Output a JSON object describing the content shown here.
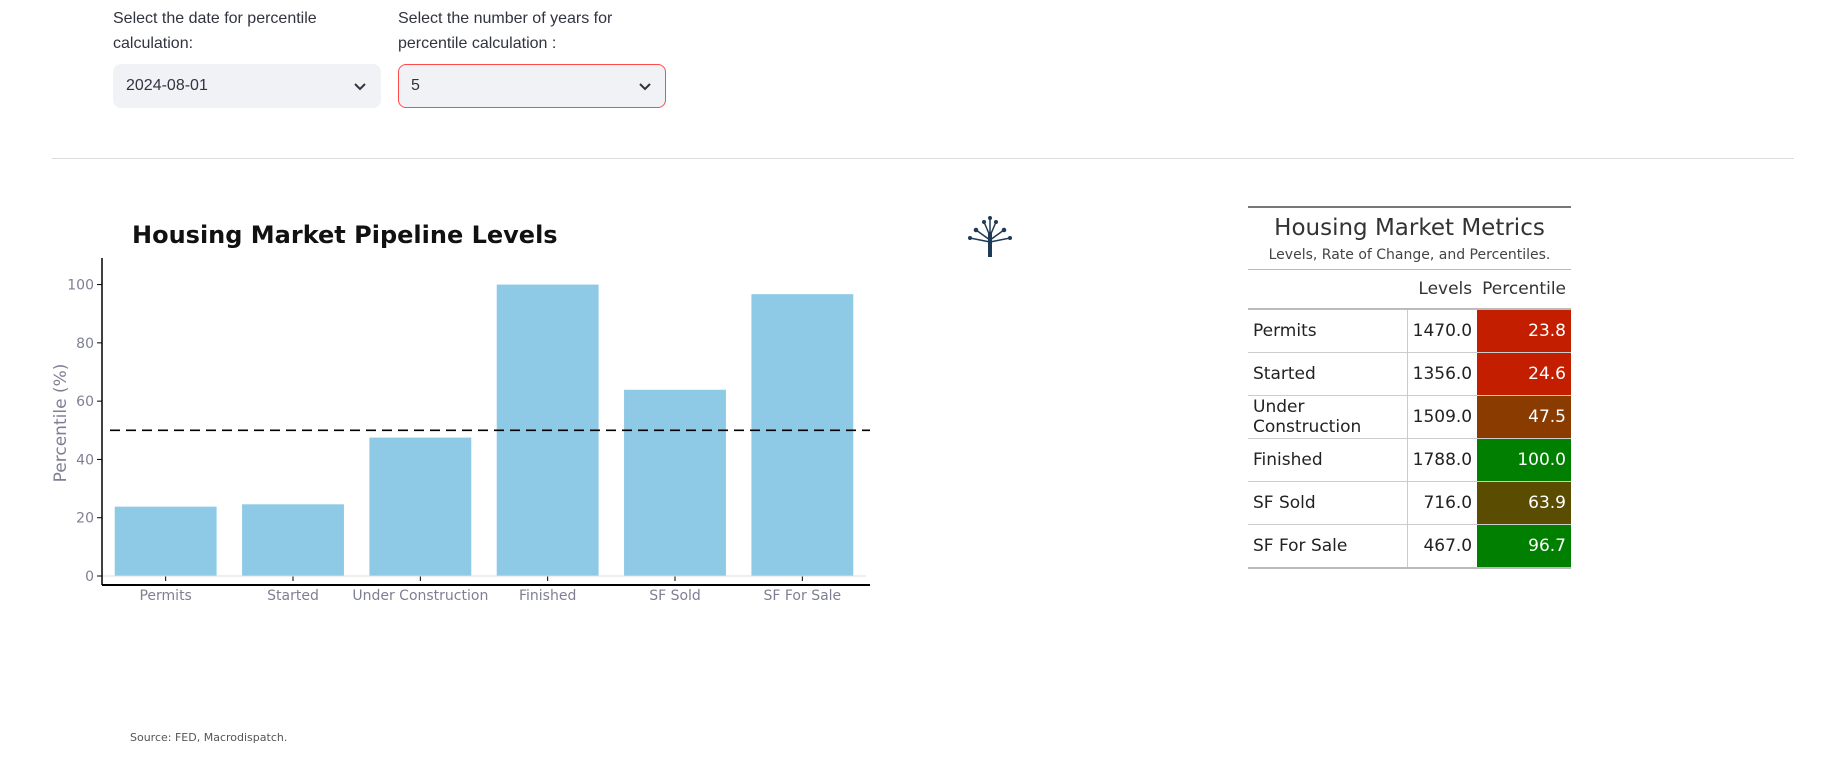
{
  "controls": {
    "date": {
      "label": "Select the date for percentile calculation:",
      "value": "2024-08-01"
    },
    "years": {
      "label": "Select the number of years for percentile calculation :",
      "value": "5"
    }
  },
  "chart_data": {
    "type": "bar",
    "title": "Housing Market Pipeline Levels",
    "categories": [
      "Permits",
      "Started",
      "Under Construction",
      "Finished",
      "SF Sold",
      "SF For Sale"
    ],
    "values": [
      23.8,
      24.6,
      47.5,
      100.0,
      63.9,
      96.7
    ],
    "xlabel": "",
    "ylabel": "Percentile (%)",
    "ylim": [
      0,
      105
    ],
    "yticks": [
      0,
      20,
      40,
      60,
      80,
      100
    ],
    "reference_line": 50,
    "bar_color": "#8ec9e6",
    "grid": false,
    "source": "Source: FED, Macrodispatch."
  },
  "metrics": {
    "title": "Housing Market Metrics",
    "subtitle": "Levels, Rate of Change, and Percentiles.",
    "columns": [
      "Levels",
      "Percentile"
    ],
    "rows": [
      {
        "name": "Permits",
        "levels": "1470.0",
        "percentile": "23.8",
        "color": "#c41e00"
      },
      {
        "name": "Started",
        "levels": "1356.0",
        "percentile": "24.6",
        "color": "#c41e00"
      },
      {
        "name": "Under Construction",
        "levels": "1509.0",
        "percentile": "47.5",
        "color": "#8a3c00"
      },
      {
        "name": "Finished",
        "levels": "1788.0",
        "percentile": "100.0",
        "color": "#007f00"
      },
      {
        "name": "SF Sold",
        "levels": "716.0",
        "percentile": "63.9",
        "color": "#5a4c00"
      },
      {
        "name": "SF For Sale",
        "levels": "467.0",
        "percentile": "96.7",
        "color": "#007f00"
      }
    ]
  },
  "logo": {
    "icon": "tree-network-icon",
    "color": "#1f3a56"
  }
}
